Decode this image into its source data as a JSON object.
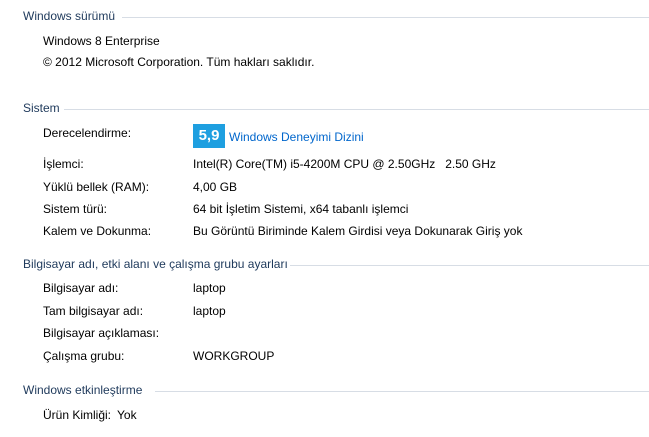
{
  "windows_edition": {
    "title": "Windows sürümü",
    "edition": "Windows 8 Enterprise",
    "copyright": "© 2012 Microsoft Corporation. Tüm hakları saklıdır."
  },
  "system": {
    "title": "Sistem",
    "rating_label": "Derecelendirme:",
    "rating_score": "5,9",
    "rating_link": "Windows Deneyimi Dizini",
    "processor_label": "İşlemci:",
    "processor_value": "Intel(R) Core(TM) i5-4200M CPU @ 2.50GHz   2.50 GHz",
    "ram_label": "Yüklü bellek (RAM):",
    "ram_value": "4,00 GB",
    "type_label": "Sistem türü:",
    "type_value": "64 bit İşletim Sistemi, x64 tabanlı işlemci",
    "pen_label": "Kalem ve Dokunma:",
    "pen_value": "Bu Görüntü Biriminde Kalem Girdisi veya Dokunarak Giriş yok"
  },
  "computer_name": {
    "title": "Bilgisayar adı, etki alanı ve çalışma grubu ayarları",
    "name_label": "Bilgisayar adı:",
    "name_value": "laptop",
    "full_name_label": "Tam bilgisayar adı:",
    "full_name_value": "laptop",
    "description_label": "Bilgisayar açıklaması:",
    "description_value": "",
    "workgroup_label": "Çalışma grubu:",
    "workgroup_value": "WORKGROUP"
  },
  "activation": {
    "title": "Windows etkinleştirme",
    "product_id_label": "Ürün Kimliği:",
    "product_id_value": "Yok"
  }
}
